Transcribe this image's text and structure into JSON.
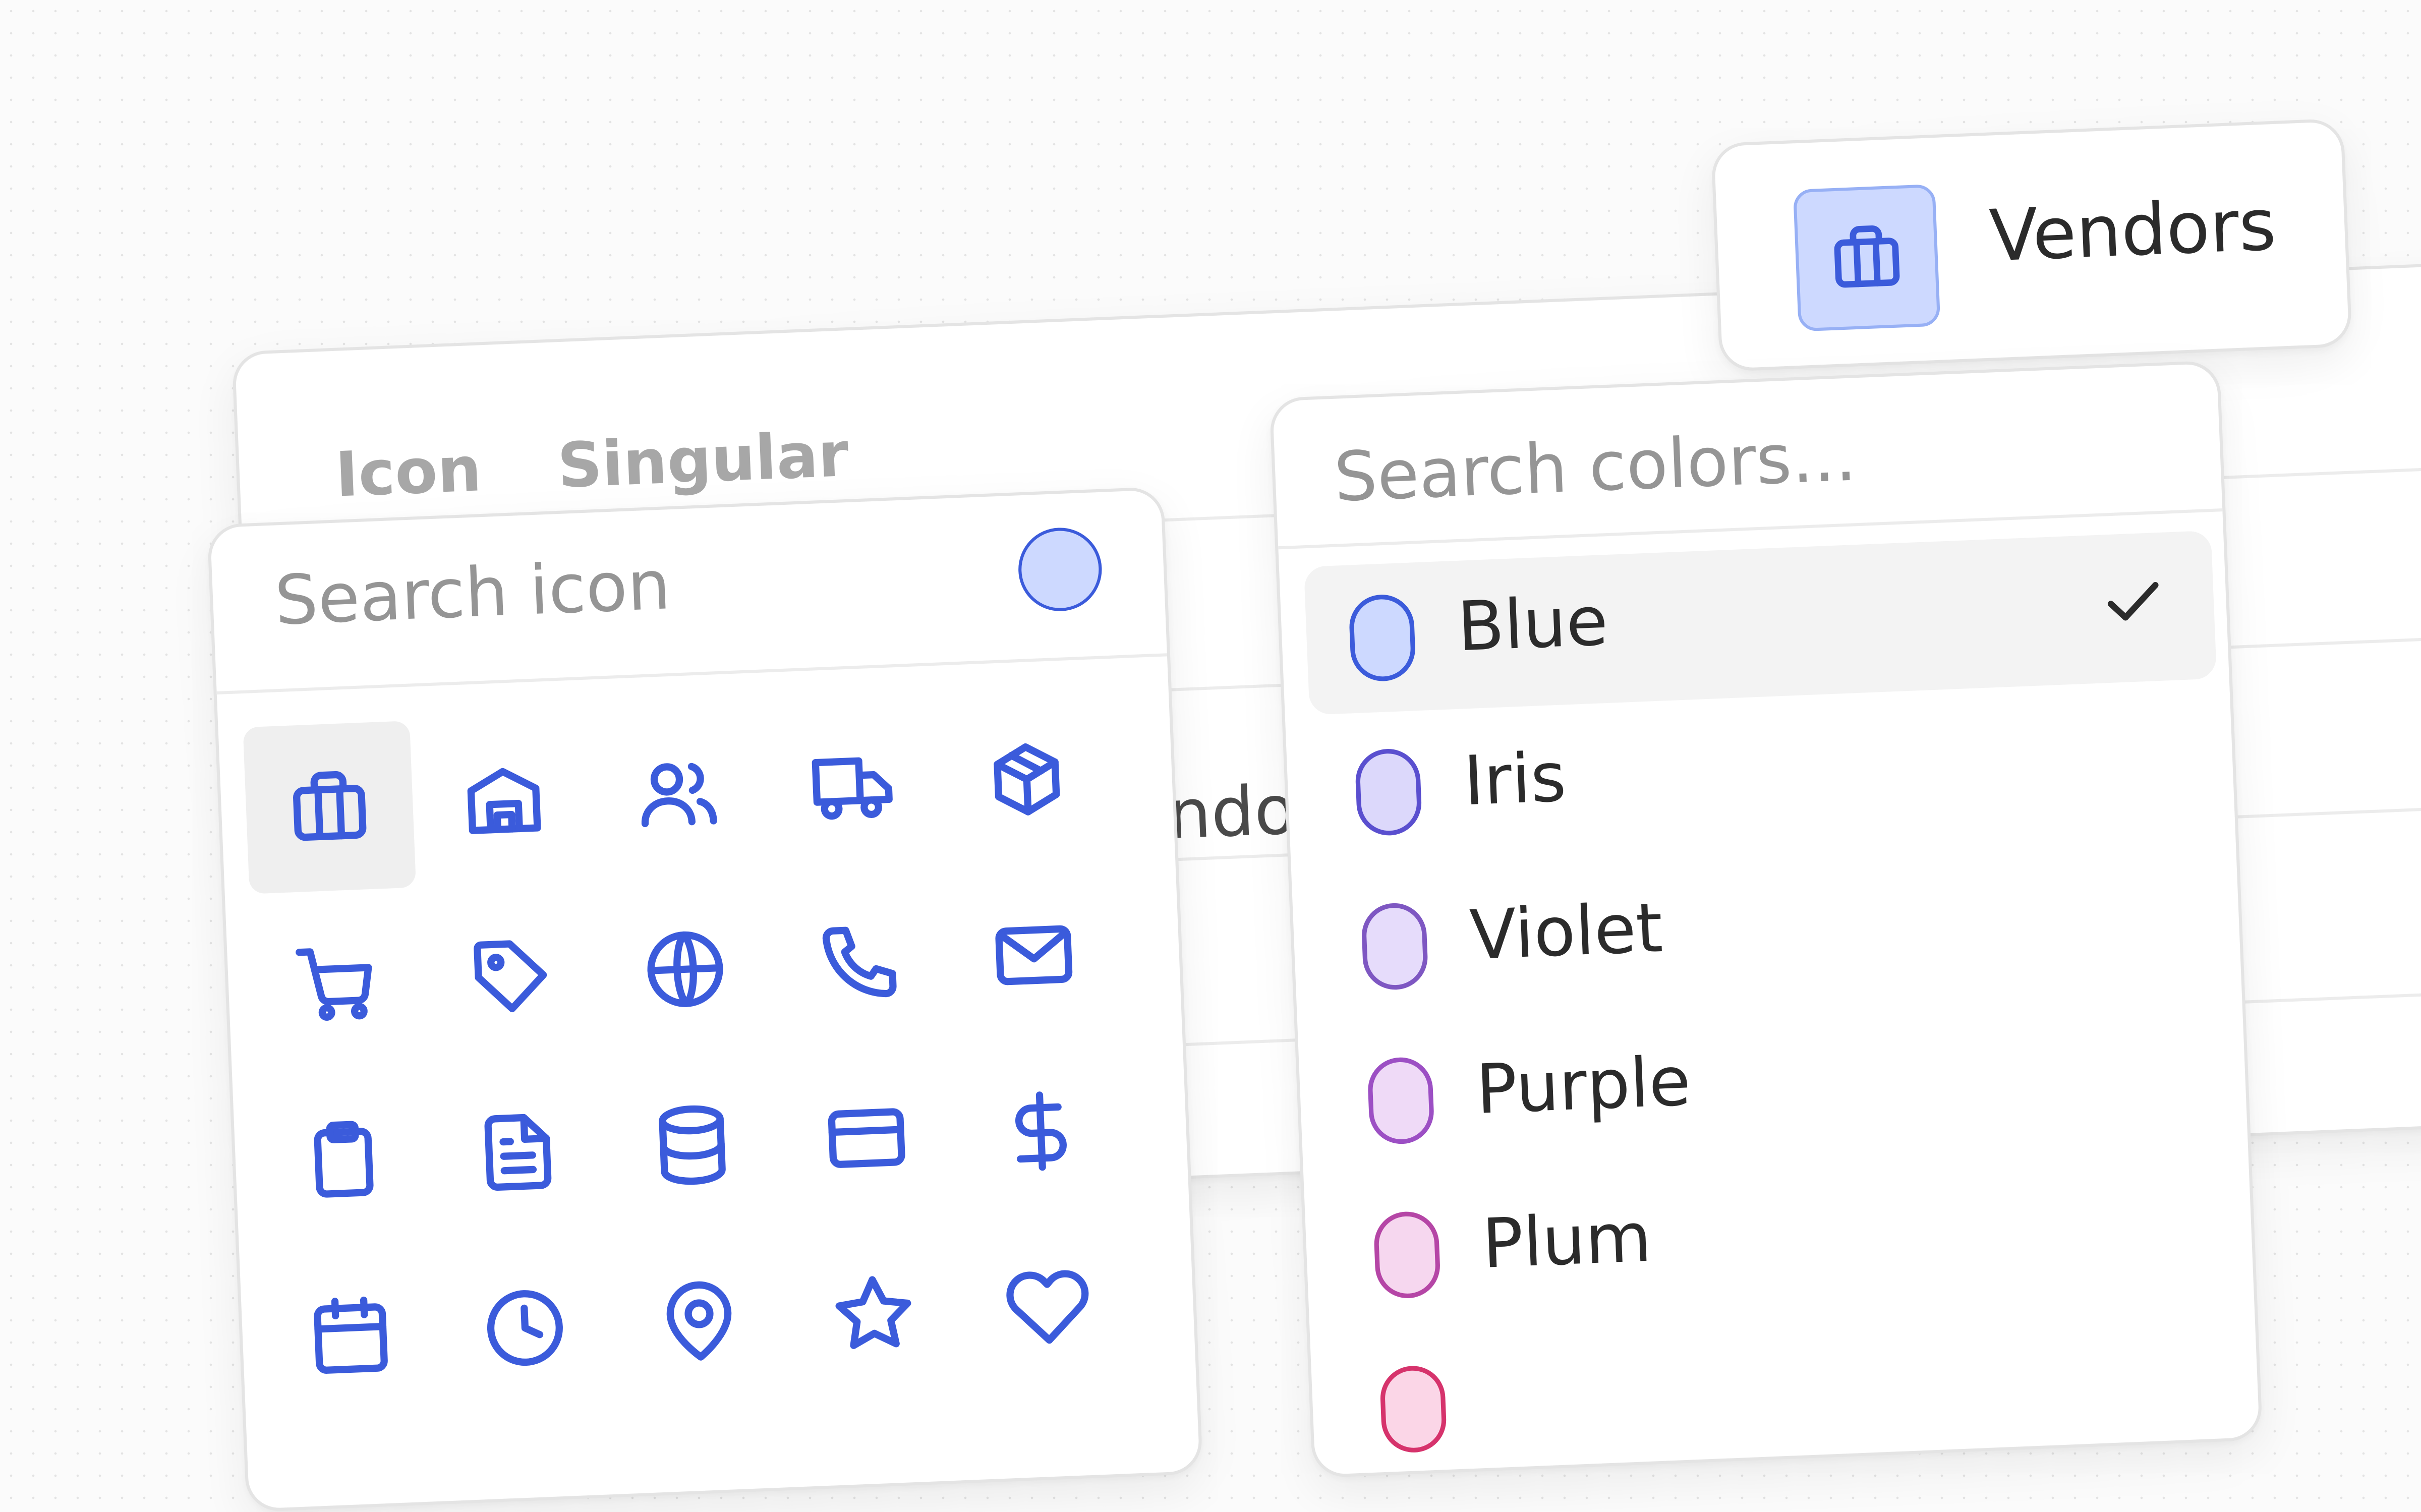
{
  "table": {
    "headers": [
      "Icon",
      "Singular"
    ],
    "partial_cell_text": "ndo"
  },
  "vendor_chip": {
    "label": "Vendors",
    "icon": "briefcase-icon",
    "background": "#cdd9ff"
  },
  "icon_picker": {
    "search_placeholder": "Search icon",
    "selected_color": "#cdd9ff",
    "accent": "#3b5bdb",
    "selected_icon": "briefcase",
    "icons": [
      "briefcase",
      "warehouse",
      "users",
      "truck",
      "package",
      "shopping-cart",
      "tag",
      "globe",
      "phone",
      "mail",
      "clipboard",
      "file-text",
      "database",
      "credit-card",
      "dollar",
      "calendar",
      "clock",
      "map-pin",
      "star",
      "heart"
    ]
  },
  "color_picker": {
    "search_placeholder": "Search colors...",
    "selected": "Blue",
    "items": [
      {
        "label": "Blue",
        "fill": "#cdd9ff",
        "stroke": "#3b5bdb"
      },
      {
        "label": "Iris",
        "fill": "#dcd8fb",
        "stroke": "#5a4fcf"
      },
      {
        "label": "Violet",
        "fill": "#e6dcfb",
        "stroke": "#7e57c2"
      },
      {
        "label": "Purple",
        "fill": "#efdaf7",
        "stroke": "#9c4fc4"
      },
      {
        "label": "Plum",
        "fill": "#f6d7ef",
        "stroke": "#b546a6"
      },
      {
        "label": "",
        "fill": "#fbd6e7",
        "stroke": "#d6336c"
      }
    ]
  }
}
